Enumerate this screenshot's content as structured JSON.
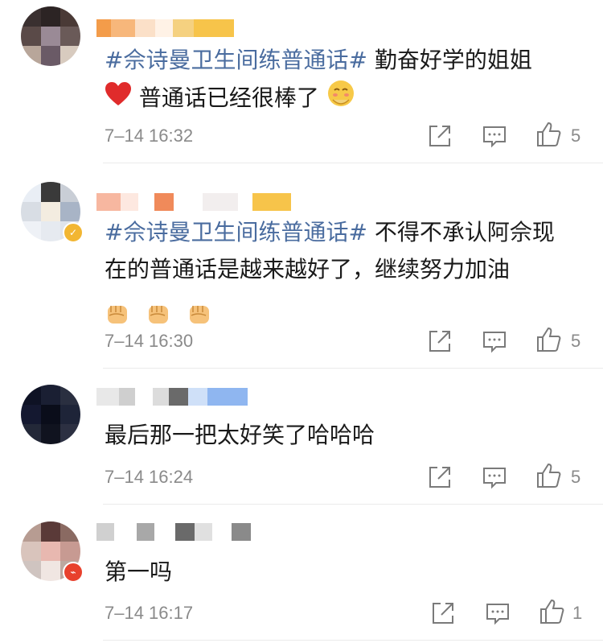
{
  "comments": [
    {
      "hashtag": "#佘诗曼卫生间练普通话#",
      "text_line1": " 勤奋好学的姐姐",
      "text_line2": " 普通话已经很棒了 ",
      "time": "7–14 16:32",
      "likes": "5"
    },
    {
      "hashtag": "#佘诗曼卫生间练普通话#",
      "text_line1": " 不得不承认阿佘现",
      "text_line2": "在的普通话是越来越好了，继续努力加油",
      "time": "7–14 16:30",
      "likes": "5"
    },
    {
      "text_line1": "最后那一把太好笑了哈哈哈",
      "time": "7–14 16:24",
      "likes": "5"
    },
    {
      "text_line1": "第一吗",
      "time": "7–14 16:17",
      "likes": "1"
    }
  ],
  "icons": {
    "share": "share-icon",
    "reply": "comment-icon",
    "like": "thumbs-up-icon",
    "heart": "red-heart-emoji",
    "blush": "blush-emoji",
    "fist": "fist-emoji"
  },
  "colors": {
    "hashtag": "#4a6c9f",
    "meta": "#8a8a8a",
    "verified": "#f2b632",
    "badge_red": "#e8412d"
  }
}
